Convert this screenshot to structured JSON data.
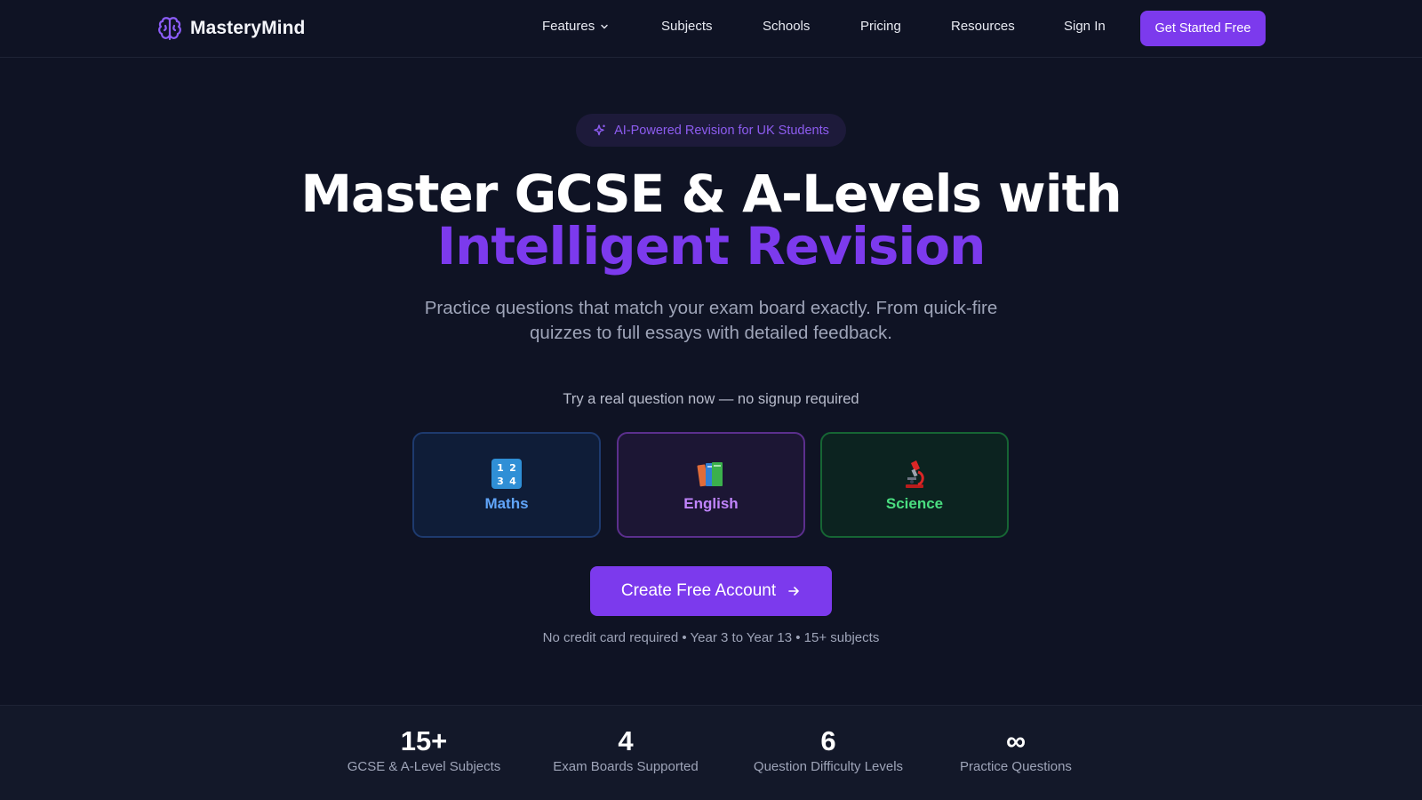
{
  "nav": {
    "brand": "MasteryMind",
    "links": [
      {
        "label": "Features",
        "has_dropdown": true
      },
      {
        "label": "Subjects"
      },
      {
        "label": "Schools"
      },
      {
        "label": "Pricing"
      },
      {
        "label": "Resources"
      },
      {
        "label": "Sign In"
      }
    ],
    "cta": "Get Started Free"
  },
  "hero": {
    "badge": "AI-Powered Revision for UK Students",
    "title_line1": "Master GCSE & A-Levels with",
    "title_line2": "Intelligent Revision",
    "subtitle": "Practice questions that match your exam board exactly. From quick-fire quizzes to full essays with detailed feedback.",
    "try_prompt": "Try a real question now — no signup required",
    "subjects": [
      {
        "label": "Maths",
        "icon": "numbers-icon",
        "color": "#60a5fa"
      },
      {
        "label": "English",
        "icon": "books-icon",
        "color": "#c084fc"
      },
      {
        "label": "Science",
        "icon": "microscope-icon",
        "color": "#4ade80"
      }
    ],
    "cta": "Create Free Account",
    "fineprint": "No credit card required • Year 3 to Year 13 • 15+ subjects"
  },
  "stats": [
    {
      "value": "15+",
      "label": "GCSE & A-Level Subjects"
    },
    {
      "value": "4",
      "label": "Exam Boards Supported"
    },
    {
      "value": "6",
      "label": "Question Difficulty Levels"
    },
    {
      "value": "∞",
      "label": "Practice Questions"
    }
  ],
  "colors": {
    "accent": "#7c3aed",
    "background": "#0f1324"
  }
}
